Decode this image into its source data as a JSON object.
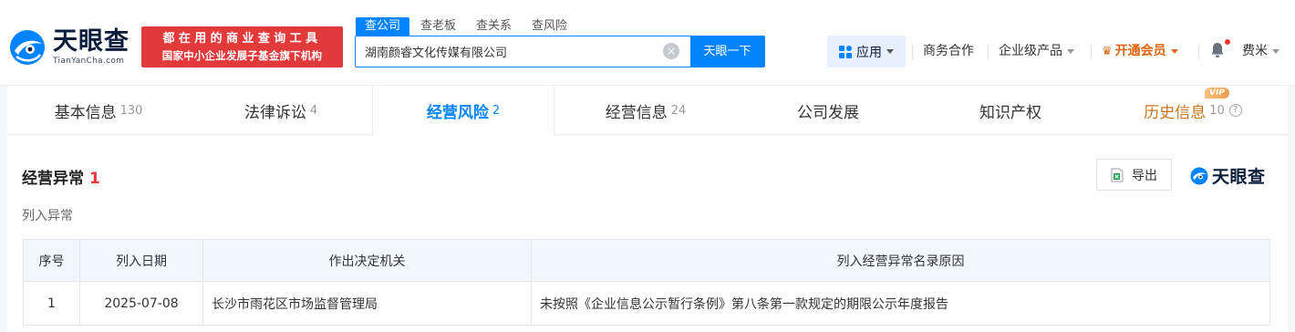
{
  "header": {
    "logo_cn": "天眼查",
    "logo_en": "TianYanCha.com",
    "slogan_line1": "都在用的商业查询工具",
    "slogan_line2": "国家中小企业发展子基金旗下机构",
    "search_tabs": [
      "查公司",
      "查老板",
      "查关系",
      "查风险"
    ],
    "search_value": "湖南颜睿文化传媒有限公司",
    "search_button": "天眼一下",
    "nav": {
      "app": "应用",
      "business": "商务合作",
      "enterprise": "企业级产品",
      "vip": "开通会员",
      "user": "费米"
    }
  },
  "tabs": [
    {
      "label": "基本信息",
      "count": "130"
    },
    {
      "label": "法律诉讼",
      "count": "4"
    },
    {
      "label": "经营风险",
      "count": "2"
    },
    {
      "label": "经营信息",
      "count": "24"
    },
    {
      "label": "公司发展",
      "count": ""
    },
    {
      "label": "知识产权",
      "count": ""
    },
    {
      "label": "历史信息",
      "count": "10"
    }
  ],
  "vip_badge": "VIP",
  "section": {
    "title": "经营异常",
    "count": "1",
    "subtitle": "列入异常",
    "export": "导出",
    "watermark": "天眼查"
  },
  "table": {
    "headers": [
      "序号",
      "列入日期",
      "作出决定机关",
      "列入经营异常名录原因"
    ],
    "rows": [
      {
        "no": "1",
        "date": "2025-07-08",
        "org": "长沙市雨花区市场监督管理局",
        "reason": "未按照《企业信息公示暂行条例》第八条第一款规定的期限公示年度报告"
      }
    ]
  },
  "colors": {
    "brand_blue": "#0084ff",
    "alert_red": "#e2393a",
    "vip_orange": "#e2640a"
  }
}
